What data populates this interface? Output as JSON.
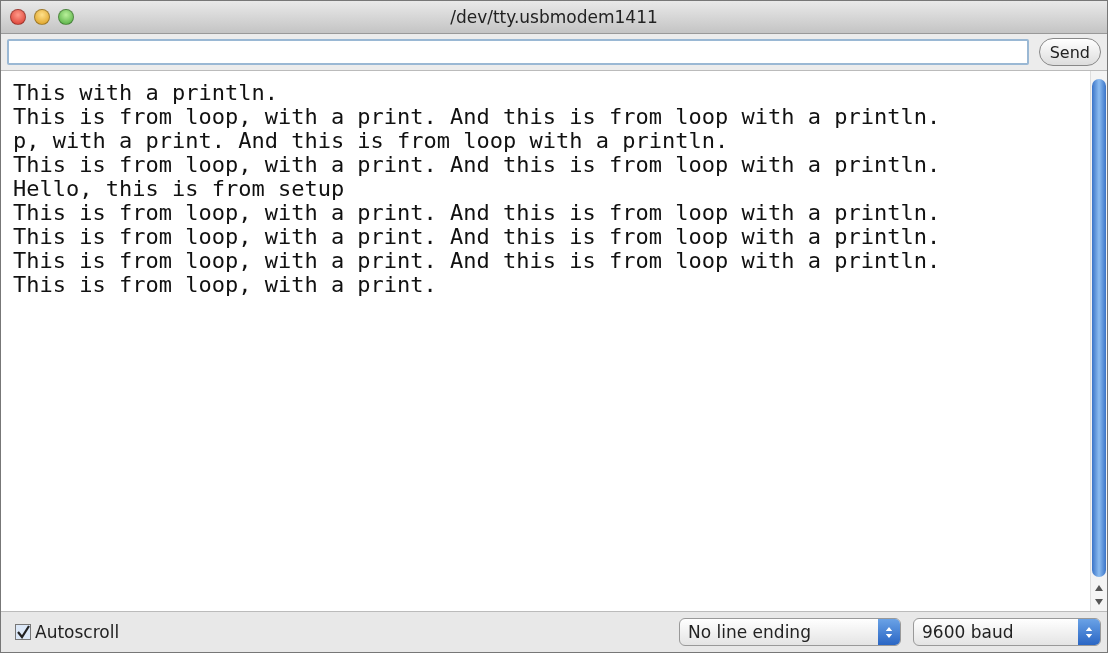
{
  "window": {
    "title": "/dev/tty.usbmodem1411"
  },
  "send_button": {
    "label": "Send"
  },
  "output_lines": [
    "This with a println.",
    "This is from loop, with a print. And this is from loop with a println.",
    "p, with a print. And this is from loop with a println.",
    "This is from loop, with a print. And this is from loop with a println.",
    "Hello, this is from setup",
    "This is from loop, with a print. And this is from loop with a println.",
    "This is from loop, with a print. And this is from loop with a println.",
    "This is from loop, with a print. And this is from loop with a println.",
    "This is from loop, with a print."
  ],
  "autoscroll": {
    "label": "Autoscroll",
    "checked": true
  },
  "line_ending": {
    "value": "No line ending"
  },
  "baud_rate": {
    "value": "9600 baud"
  }
}
